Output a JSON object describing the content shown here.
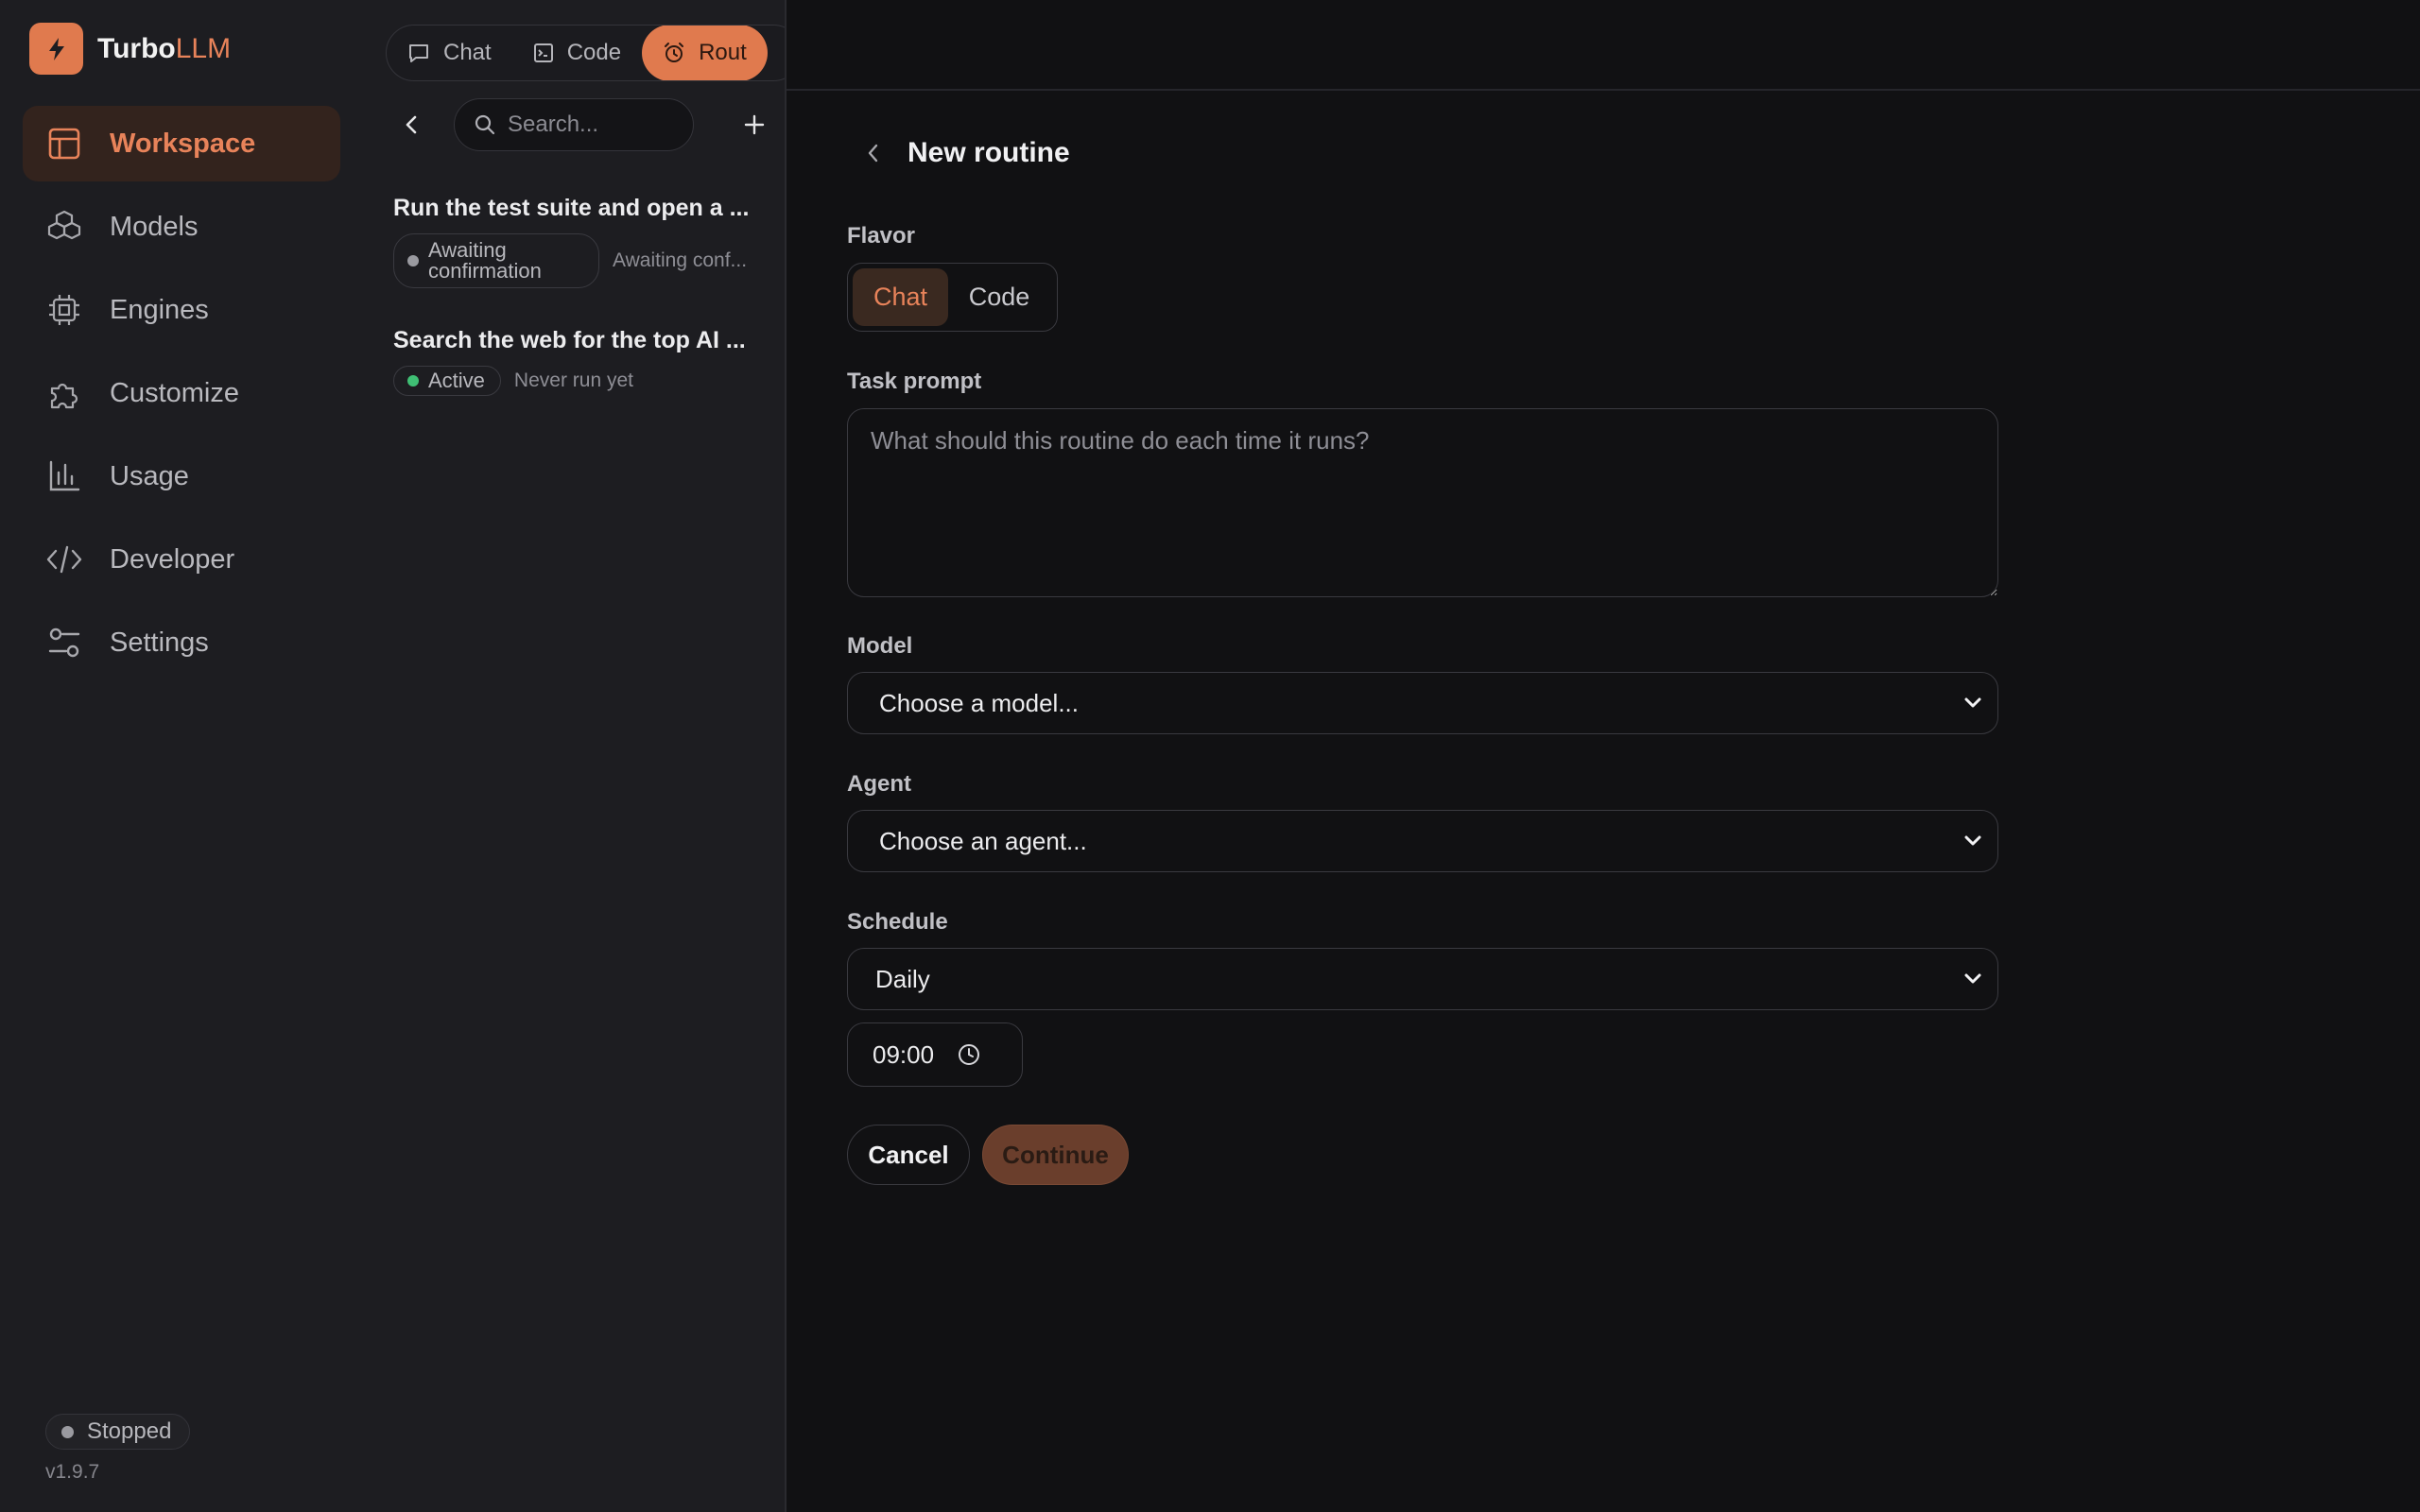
{
  "app": {
    "brand_primary": "Turbo",
    "brand_accent": "LLM",
    "accent_color": "#e07a4e",
    "version": "v1.9.7",
    "engine_status": "Stopped"
  },
  "nav": {
    "items": [
      {
        "label": "Workspace",
        "icon": "layout-icon",
        "active": true
      },
      {
        "label": "Models",
        "icon": "cubes-icon"
      },
      {
        "label": "Engines",
        "icon": "cpu-icon"
      },
      {
        "label": "Customize",
        "icon": "puzzle-icon"
      },
      {
        "label": "Usage",
        "icon": "bar-chart-icon"
      },
      {
        "label": "Developer",
        "icon": "code-icon"
      },
      {
        "label": "Settings",
        "icon": "sliders-icon"
      }
    ]
  },
  "panel": {
    "tabs": [
      {
        "label": "Chat",
        "icon": "chat-bubble-icon"
      },
      {
        "label": "Code",
        "icon": "terminal-icon"
      },
      {
        "label": "Rout",
        "icon": "alarm-clock-icon",
        "active": true
      }
    ],
    "search_placeholder": "Search...",
    "routines": [
      {
        "title": "Run the test suite and open a ...",
        "status": "Awaiting confirmation",
        "status_color": "#9a9aa0",
        "meta": "Awaiting conf..."
      },
      {
        "title": "Search the web for the top AI ...",
        "status": "Active",
        "status_color": "#3fbf74",
        "meta": "Never run yet"
      }
    ]
  },
  "form": {
    "title": "New routine",
    "flavor_label": "Flavor",
    "flavor_options": [
      "Chat",
      "Code"
    ],
    "flavor_selected": "Chat",
    "prompt_label": "Task prompt",
    "prompt_placeholder": "What should this routine do each time it runs?",
    "model_label": "Model",
    "model_value": "Choose a model...",
    "agent_label": "Agent",
    "agent_value": "Choose an agent...",
    "schedule_label": "Schedule",
    "schedule_value": "Daily",
    "time_value": "09:00",
    "cancel_label": "Cancel",
    "continue_label": "Continue"
  }
}
